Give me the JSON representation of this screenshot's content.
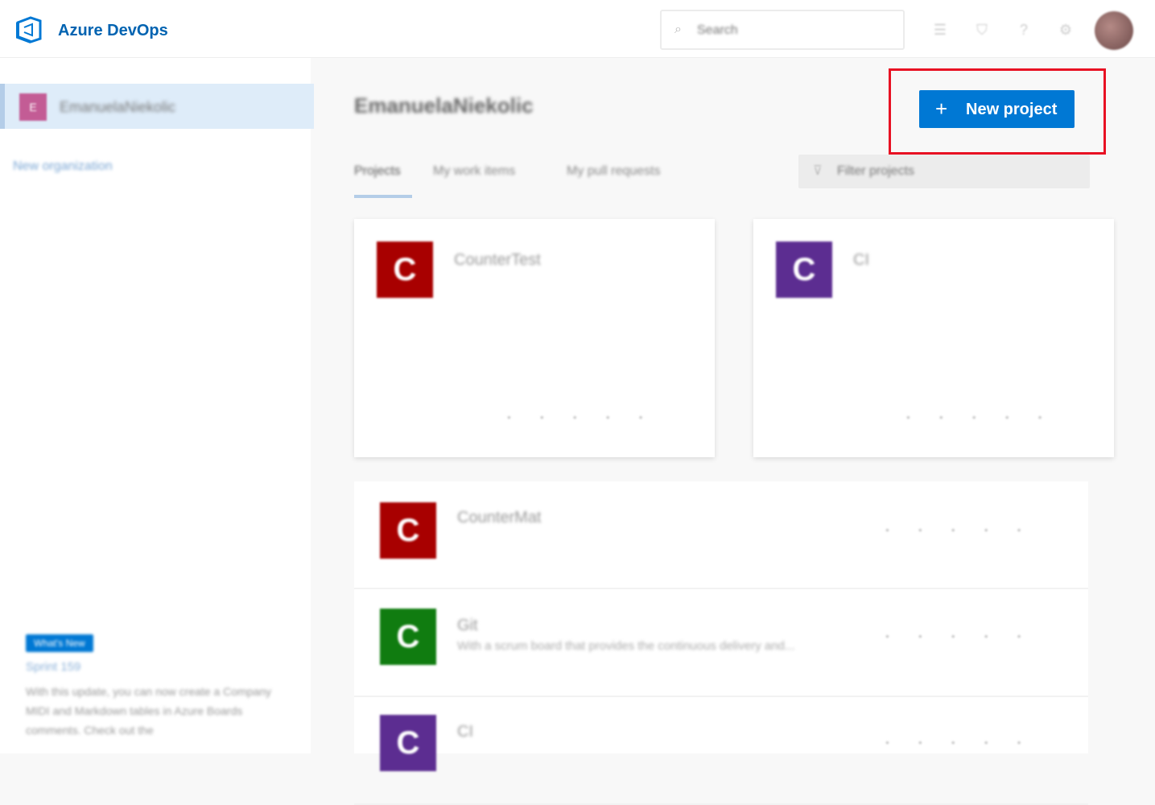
{
  "header": {
    "brand": "Azure DevOps",
    "search_placeholder": "Search"
  },
  "sidebar": {
    "org_badge": "E",
    "org_name": "EmanuelaNiekolic",
    "new_org_label": "New organization",
    "promo": {
      "badge": "What's New",
      "title": "Sprint 159",
      "text": "With this update, you can now create a Company MIDI and Markdown tables in Azure Boards comments. Check out the"
    }
  },
  "main": {
    "title": "EmanuelaNiekolic",
    "new_project_label": "New project",
    "tabs": [
      {
        "label": "Projects",
        "active": true
      },
      {
        "label": "My work items",
        "active": false
      },
      {
        "label": "My pull requests",
        "active": false
      }
    ],
    "filter_placeholder": "Filter projects",
    "cards": [
      {
        "initial": "C",
        "name": "CounterTest",
        "color": "#a80000"
      },
      {
        "initial": "C",
        "name": "CI",
        "color": "#5c2d91"
      }
    ],
    "list": [
      {
        "initial": "C",
        "name": "CounterMat",
        "description": "",
        "color": "#a80000"
      },
      {
        "initial": "C",
        "name": "Git",
        "description": "With a scrum board that provides the continuous delivery and...",
        "color": "#107c10"
      },
      {
        "initial": "C",
        "name": "CI",
        "description": "",
        "color": "#5c2d91"
      }
    ]
  },
  "colors": {
    "accent": "#0078d4",
    "highlight": "#e81123"
  }
}
